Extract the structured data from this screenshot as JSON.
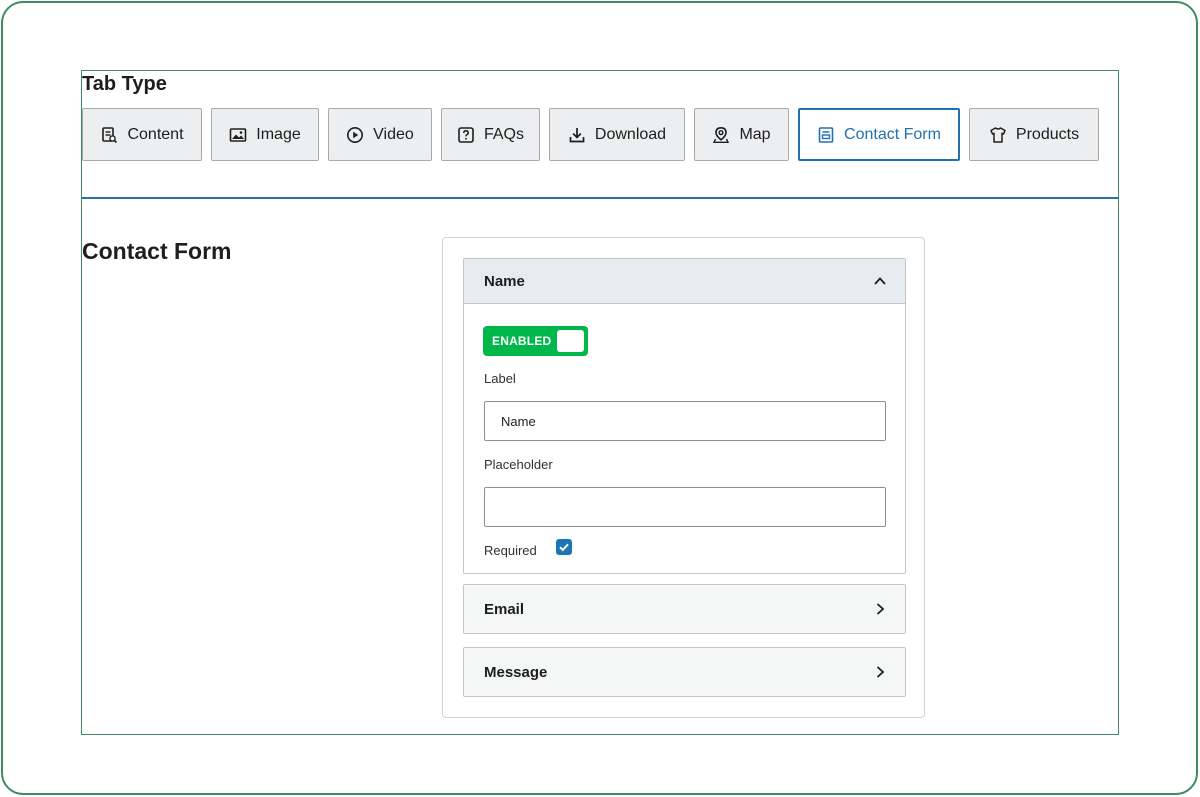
{
  "tab_type": {
    "title": "Tab Type",
    "tabs": [
      {
        "label": "Content",
        "icon": "content-icon",
        "active": false
      },
      {
        "label": "Image",
        "icon": "image-icon",
        "active": false
      },
      {
        "label": "Video",
        "icon": "play-icon",
        "active": false
      },
      {
        "label": "FAQs",
        "icon": "question-icon",
        "active": false
      },
      {
        "label": "Download",
        "icon": "download-icon",
        "active": false
      },
      {
        "label": "Map",
        "icon": "map-pin-icon",
        "active": false
      },
      {
        "label": "Contact Form",
        "icon": "form-icon",
        "active": true
      },
      {
        "label": "Products",
        "icon": "shirt-icon",
        "active": false
      }
    ]
  },
  "contact_form": {
    "title": "Contact Form",
    "fields": [
      {
        "name": "Name",
        "expanded": true,
        "toggle_label": "ENABLED",
        "label_caption": "Label",
        "label_value": "Name",
        "placeholder_caption": "Placeholder",
        "placeholder_value": "",
        "required_caption": "Required",
        "required": true
      },
      {
        "name": "Email",
        "expanded": false
      },
      {
        "name": "Message",
        "expanded": false
      }
    ]
  },
  "colors": {
    "frame": "#3d8a63",
    "accent": "#2271b1",
    "toggle_on": "#00b74a",
    "checkbox": "#1b76b5"
  }
}
